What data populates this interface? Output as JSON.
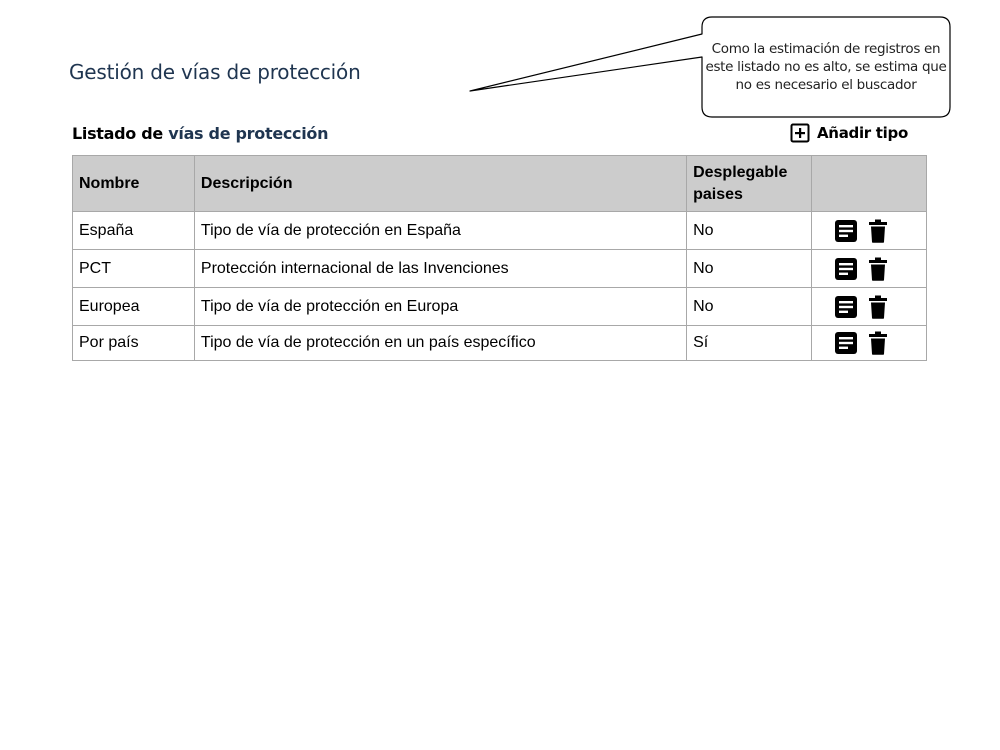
{
  "page": {
    "title": "Gestión de vías de protección"
  },
  "callout": {
    "text": "Como la estimación de registros en este listado no es alto, se estima que no es necesario el buscador"
  },
  "listing": {
    "heading_prefix": "Listado de ",
    "heading_accent": "vías de protección",
    "add_label": "Añadir tipo"
  },
  "table": {
    "headers": {
      "name": "Nombre",
      "description": "Descripción",
      "dropdown": "Desplegable paises",
      "actions": ""
    },
    "rows": [
      {
        "name": "España",
        "description": "Tipo de vía de protección en España",
        "dropdown": "No"
      },
      {
        "name": "PCT",
        "description": "Protección internacional de las Invenciones",
        "dropdown": "No"
      },
      {
        "name": "Europea",
        "description": "Tipo de vía de protección en Europa",
        "dropdown": "No"
      },
      {
        "name": "Por país",
        "description": "Tipo de vía de protección en un país específico",
        "dropdown": "Sí"
      }
    ]
  },
  "icons": {
    "add": "add-box-icon",
    "edit": "document-icon",
    "delete": "trash-icon"
  },
  "colors": {
    "accent": "#1f3550",
    "header_bg": "#cccccc",
    "border": "#a8a8a8"
  }
}
